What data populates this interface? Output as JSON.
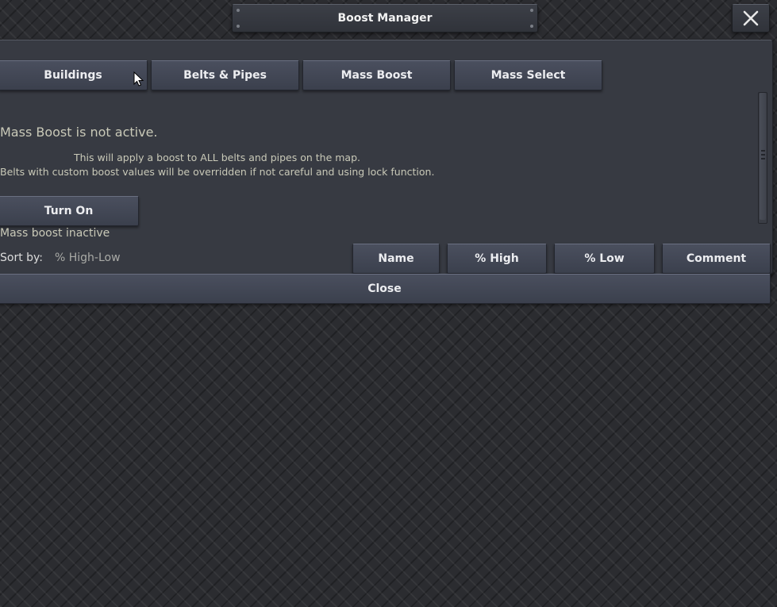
{
  "window": {
    "title": "Boost Manager",
    "close_icon": "close-icon"
  },
  "tabs": [
    {
      "label": "Buildings"
    },
    {
      "label": "Belts & Pipes"
    },
    {
      "label": "Mass Boost"
    },
    {
      "label": "Mass Select"
    }
  ],
  "mass_boost": {
    "status_heading": "Mass Boost is not active.",
    "description_line1": "This will apply a boost to ALL belts and pipes on the map.",
    "description_line2": "Belts with custom boost values will be overridden if not careful and using lock function.",
    "toggle_button_label": "Turn On",
    "status_text": "Mass boost inactive"
  },
  "sort": {
    "label": "Sort by:",
    "current_value": "% High-Low",
    "buttons": [
      {
        "label": "Name"
      },
      {
        "label": "% High"
      },
      {
        "label": "% Low"
      },
      {
        "label": "Comment"
      }
    ]
  },
  "footer": {
    "close_label": "Close"
  },
  "colors": {
    "text_muted": "#c9c9b8",
    "button_text": "#ecedf0",
    "panel_bg": "#373a42"
  }
}
